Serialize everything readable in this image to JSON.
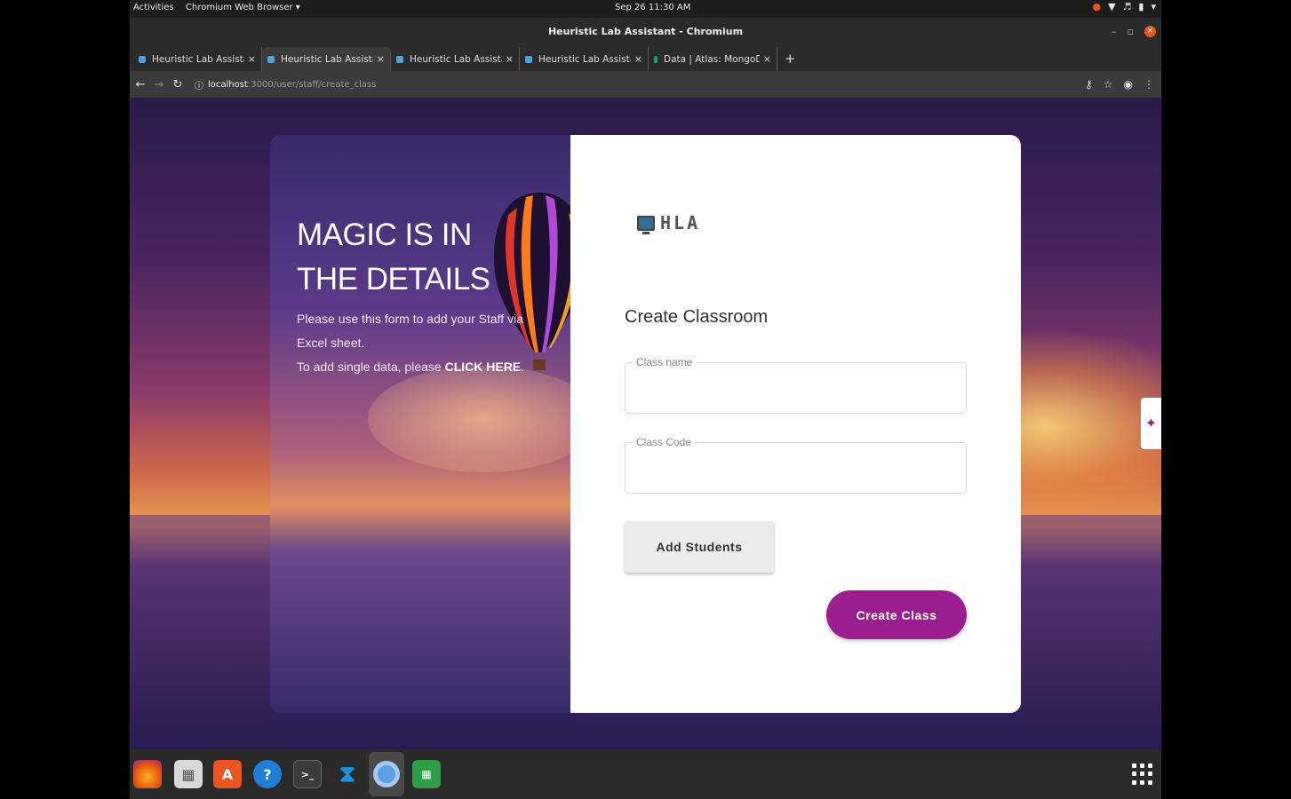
{
  "topbar": {
    "activities": "Activities",
    "app_menu": "Chromium Web Browser ▾",
    "clock": "Sep 26  11:30 AM"
  },
  "window": {
    "title": "Heuristic Lab Assistant - Chromium"
  },
  "tabs": [
    {
      "label": "Heuristic Lab Assistant"
    },
    {
      "label": "Heuristic Lab Assistant"
    },
    {
      "label": "Heuristic Lab Assistant"
    },
    {
      "label": "Heuristic Lab Assistant"
    },
    {
      "label": "Data | Atlas: MongoDB Atl"
    }
  ],
  "address_bar": {
    "host": "localhost",
    "path": ":3000/user/staff/create_class"
  },
  "hero": {
    "headline": "MAGIC IS IN THE DETAILS",
    "line1": "Please use this form to add your Staff via Excel sheet.",
    "line2_prefix": "To add single data, please ",
    "line2_link": "CLICK HERE",
    "line2_suffix": "."
  },
  "form": {
    "logo_text": "HLA",
    "title": "Create Classroom",
    "class_name_label": "Class name",
    "class_code_label": "Class Code",
    "class_name_value": "",
    "class_code_value": "",
    "add_students_label": "Add Students",
    "create_class_label": "Create Class"
  },
  "colors": {
    "primary_button": "#9b1e8f",
    "ubuntu_orange": "#e95420"
  },
  "dock": [
    "firefox-icon",
    "files-icon",
    "software-icon",
    "help-icon",
    "terminal-icon",
    "vscode-icon",
    "chromium-icon",
    "spreadsheet-icon"
  ]
}
